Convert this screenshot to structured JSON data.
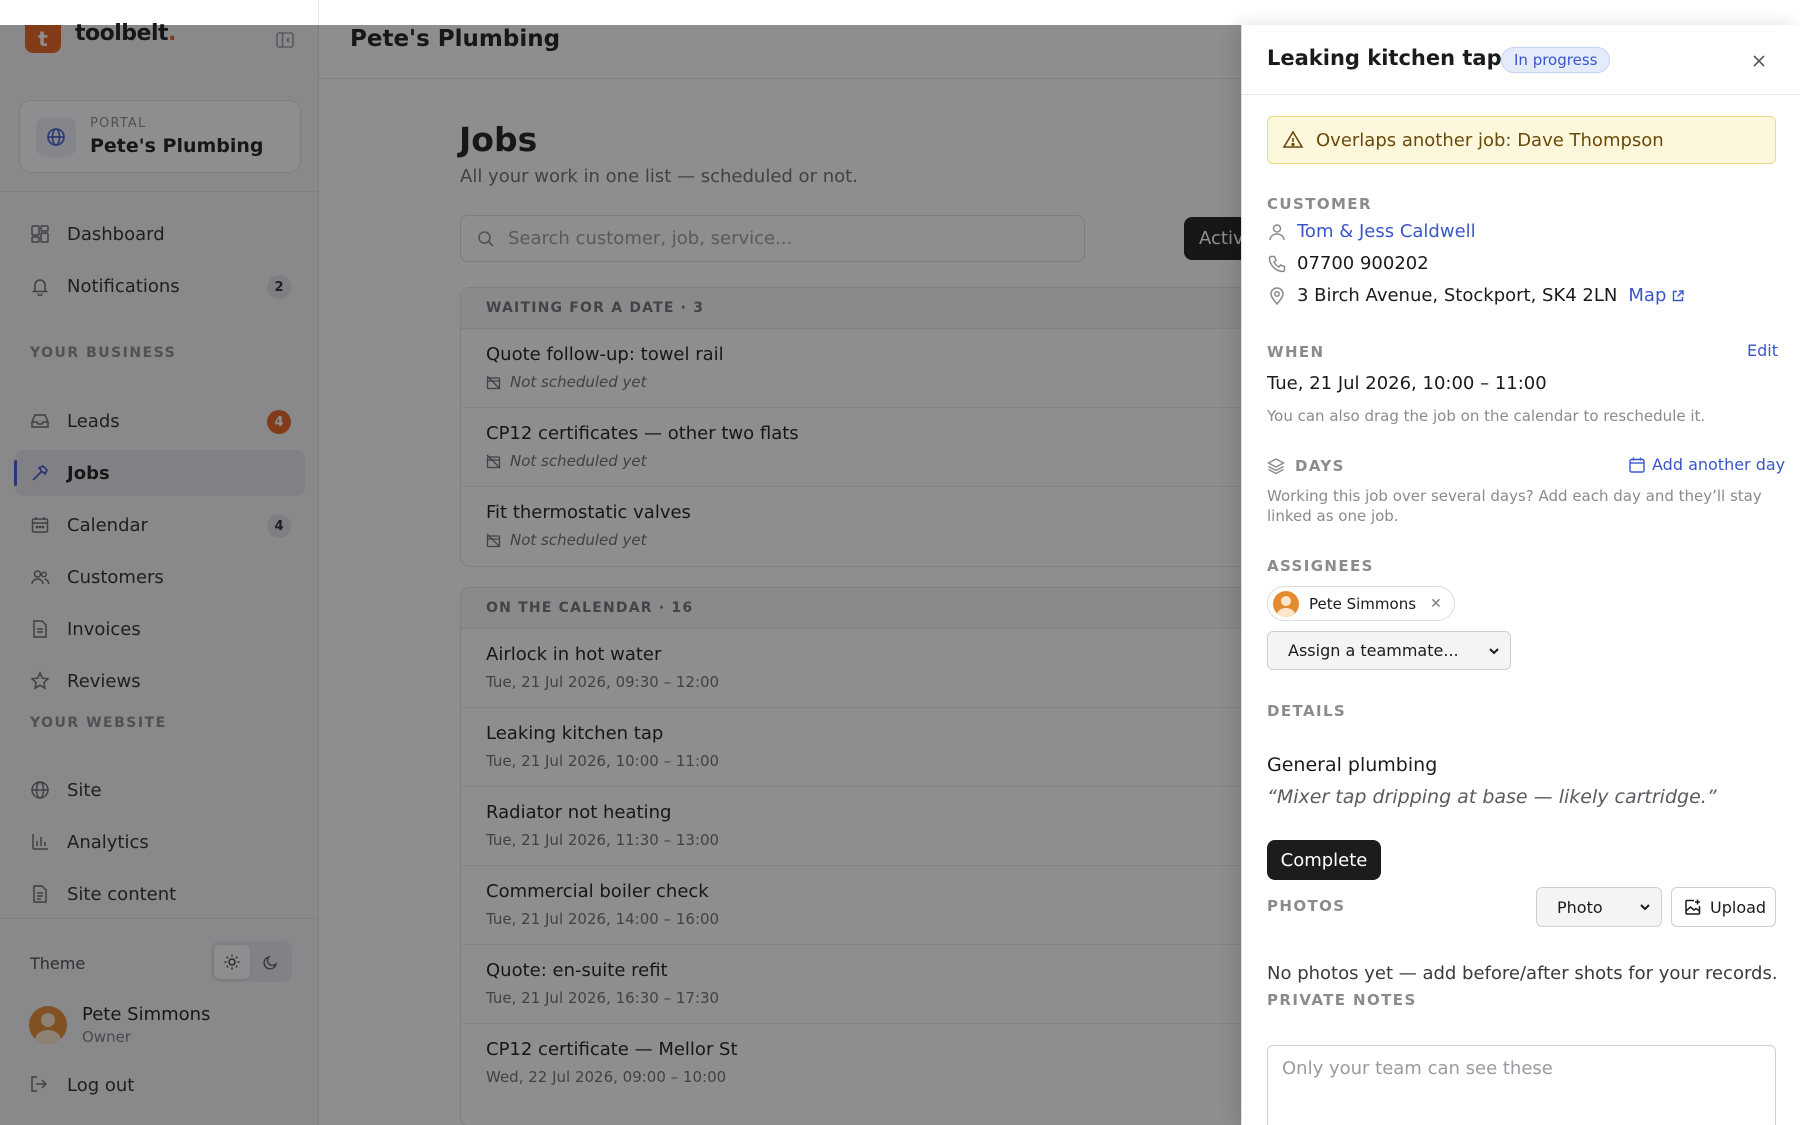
{
  "brand": {
    "logo_letter": "t",
    "name": "toolbelt",
    "name_dot": "."
  },
  "portal": {
    "label": "PORTAL",
    "name": "Pete's Plumbing"
  },
  "sidebar": {
    "items": [
      {
        "label": "Dashboard",
        "icon": "dashboard-icon"
      },
      {
        "label": "Notifications",
        "icon": "bell-icon",
        "badge": "2"
      },
      {
        "label": "Leads",
        "icon": "inbox-icon",
        "badge": "4"
      },
      {
        "label": "Jobs",
        "icon": "hammer-icon",
        "active": true
      },
      {
        "label": "Calendar",
        "icon": "calendar-icon",
        "badge": "4"
      },
      {
        "label": "Customers",
        "icon": "users-icon"
      },
      {
        "label": "Invoices",
        "icon": "document-icon"
      },
      {
        "label": "Reviews",
        "icon": "star-icon"
      },
      {
        "label": "Site",
        "icon": "globe-icon"
      },
      {
        "label": "Analytics",
        "icon": "bar-chart-icon"
      },
      {
        "label": "Site content",
        "icon": "file-icon"
      }
    ],
    "section_business": "YOUR BUSINESS",
    "section_website": "YOUR WEBSITE",
    "theme_label": "Theme",
    "user": {
      "name": "Pete Simmons",
      "role": "Owner"
    },
    "logout": "Log out"
  },
  "main": {
    "header_title": "Pete's Plumbing",
    "page_title": "Jobs",
    "page_subtitle": "All your work in one list — scheduled or not.",
    "search_placeholder": "Search customer, job, service...",
    "filter_active": "Activ"
  },
  "waiting": {
    "header": "WAITING FOR A DATE · 3",
    "jobs": [
      {
        "title": "Quote follow-up: towel rail",
        "meta": "Not scheduled yet"
      },
      {
        "title": "CP12 certificates — other two flats",
        "meta": "Not scheduled yet"
      },
      {
        "title": "Fit thermostatic valves",
        "meta": "Not scheduled yet"
      }
    ]
  },
  "calendar": {
    "header": "ON THE CALENDAR · 16",
    "jobs": [
      {
        "title": "Airlock in hot water",
        "meta": "Tue, 21 Jul 2026, 09:30 – 12:00"
      },
      {
        "title": "Leaking kitchen tap",
        "meta": "Tue, 21 Jul 2026, 10:00 – 11:00"
      },
      {
        "title": "Radiator not heating",
        "meta": "Tue, 21 Jul 2026, 11:30 – 13:00"
      },
      {
        "title": "Commercial boiler check",
        "meta": "Tue, 21 Jul 2026, 14:00 – 16:00"
      },
      {
        "title": "Quote: en-suite refit",
        "meta": "Tue, 21 Jul 2026, 16:30 – 17:30"
      },
      {
        "title": "CP12 certificate — Mellor St",
        "meta": "Wed, 22 Jul 2026, 09:00 – 10:00"
      }
    ]
  },
  "drawer": {
    "title": "Leaking kitchen tap",
    "status": "In progress",
    "warning": "Overlaps another job: Dave Thompson",
    "customer_label": "CUSTOMER",
    "customer_name": "Tom & Jess Caldwell",
    "phone": "07700 900202",
    "address": "3 Birch Avenue, Stockport, SK4 2LN",
    "map_link": "Map",
    "when_label": "WHEN",
    "edit_link": "Edit",
    "when_value": "Tue, 21 Jul 2026, 10:00 – 11:00",
    "when_hint": "You can also drag the job on the calendar to reschedule it.",
    "days_label": "DAYS",
    "add_day": "Add another day",
    "days_hint_1": "Working this job over several days? Add each day and they’ll stay",
    "days_hint_2": "linked as one job.",
    "assignees_label": "ASSIGNEES",
    "assignee": "Pete Simmons",
    "assign_select": "Assign a teammate...",
    "details_label": "DETAILS",
    "details_main": "General plumbing",
    "details_quote": "“Mixer tap dripping at base — likely cartridge.”",
    "complete_button": "Complete",
    "photos_label": "PHOTOS",
    "photo_type": "Photo",
    "upload_button": "Upload",
    "photos_empty": "No photos yet — add before/after shots for your records.",
    "notes_label": "PRIVATE NOTES",
    "notes_placeholder": "Only your team can see these"
  },
  "colors": {
    "accent": "#3a56c9",
    "brand": "#e8631c",
    "warning_bg": "#fdf7dc"
  }
}
